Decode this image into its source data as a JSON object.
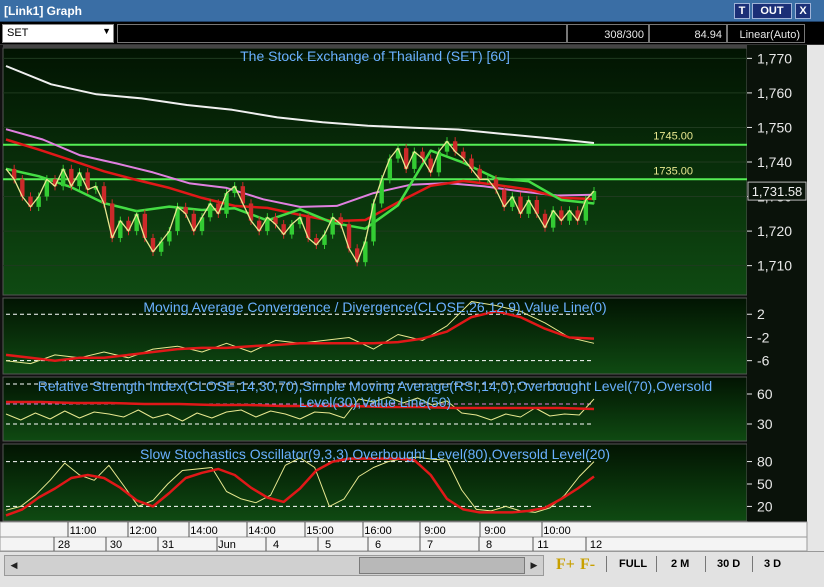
{
  "window": {
    "title": "[Link1] Graph",
    "buttons": [
      "T",
      "OUT",
      "X"
    ]
  },
  "toolbar": {
    "symbol": "SET",
    "count": "308/300",
    "value": "84.94",
    "scale": "Linear(Auto)"
  },
  "colors": {
    "bg": "#0d2a0d",
    "grid": "#3a4a3a",
    "green_up": "#33cc33",
    "red_down": "#cc2a2a",
    "line_white": "#f0f0f0",
    "line_pink": "#e080e0",
    "line_red": "#e01818",
    "line_green": "#44dd44",
    "line_yellow": "#e8e890",
    "level": "#55ee55"
  },
  "chart_data": [
    {
      "type": "line",
      "title": "The Stock Exchange of Thailand (SET) [60]",
      "y_ticks": [
        1770,
        1760,
        1750,
        1740,
        1730,
        1720,
        1710
      ],
      "ylim": [
        1701.5,
        1773
      ],
      "price_label": "1,731.58",
      "annotations": [
        {
          "label": "1745.00",
          "y": 1745
        },
        {
          "label": "1735.00",
          "y": 1735
        }
      ],
      "series": [
        {
          "values": [
            1738,
            1735,
            1730,
            1727,
            1730,
            1735,
            1733,
            1738,
            1733,
            1737,
            1732,
            1733,
            1728,
            1718,
            1723,
            1720,
            1725,
            1718,
            1714,
            1717,
            1720,
            1727,
            1725,
            1720,
            1724,
            1728,
            1725,
            1731,
            1733,
            1728,
            1723,
            1720,
            1724,
            1722,
            1719,
            1722,
            1724,
            1718,
            1716,
            1719,
            1724,
            1722,
            1715,
            1711,
            1717,
            1728,
            1735,
            1741,
            1744,
            1738,
            1743,
            1741,
            1737,
            1743,
            1746,
            1743,
            1741,
            1738,
            1735,
            1735,
            1732,
            1727,
            1730,
            1725,
            1729,
            1725,
            1721,
            1726,
            1723,
            1726,
            1723,
            1729,
            1731.58
          ]
        },
        {
          "values": [
            1767.8,
            1762.5,
            1759.6,
            1758.4,
            1756.5,
            1755.1,
            1752.9,
            1751.5,
            1750.5,
            1749.9,
            1749.4,
            1748.1,
            1746.9,
            1745.5
          ]
        },
        {
          "values": [
            1749.5,
            1746.5,
            1742,
            1739.6,
            1737,
            1733.8,
            1732.5,
            1729.2,
            1727,
            1727.3,
            1731,
            1733.4,
            1733.9,
            1733,
            1731.5,
            1730.3,
            1730.5
          ]
        },
        {
          "values": [
            1746.5,
            1743.6,
            1740.5,
            1737.3,
            1734.8,
            1732.5,
            1729.6,
            1727.3,
            1726.7,
            1724.7,
            1722.9,
            1723.2,
            1728.3,
            1733.1,
            1734.5,
            1733.4,
            1732,
            1729.6,
            1729.3
          ]
        },
        {
          "values": [
            1738,
            1735.9,
            1732.7,
            1728.1,
            1725.8,
            1727.1,
            1726.1,
            1726.6,
            1723.1,
            1726.3,
            1722.4,
            1720.7,
            1727.5,
            1743.3,
            1739.8,
            1735.3,
            1734.4,
            1729,
            1728
          ]
        }
      ]
    },
    {
      "type": "line",
      "title": "Moving Average Convergence / Divergence(CLOSE,26,12,9),Value Line(0)",
      "y_ticks": [
        2,
        -2,
        -6
      ],
      "ylim": [
        -8.3,
        4.8
      ],
      "series": [
        {
          "values": [
            -6,
            -6.5,
            -5,
            -5.5,
            -4.5,
            -5.5,
            -4,
            -3.5,
            -4.5,
            -3,
            -4.5,
            -2.5,
            -3,
            -2.5,
            -2,
            -4,
            -1.5,
            -2.5,
            0,
            4.2,
            3.5,
            2.5,
            0.5,
            -2,
            -3
          ]
        },
        {
          "values": [
            -5,
            -5.5,
            -6,
            -5.5,
            -5.5,
            -5,
            -4.5,
            -4,
            -3.8,
            -3.8,
            -3.5,
            -3.3,
            -3,
            -3,
            -3,
            -3,
            -2.8,
            -2.2,
            -1,
            1.5,
            2.5,
            1.5,
            -0.5,
            -2,
            -2.2
          ]
        }
      ]
    },
    {
      "type": "line",
      "title": "Relative Strength Index(CLOSE,14,30,70),Simple Moving Average(RSI,14,0),Overbought Level(70),Oversold Level(30),Value Line(50)",
      "y_ticks": [
        60,
        30
      ],
      "ylim": [
        13,
        77
      ],
      "series": [
        {
          "values": [
            40,
            34,
            41,
            35,
            43,
            36,
            42,
            40,
            37,
            44,
            36,
            40,
            33,
            41,
            36,
            42,
            44,
            37,
            43,
            40,
            35,
            42,
            41,
            36,
            55,
            52,
            57,
            51,
            56,
            49,
            53,
            41,
            39,
            34,
            40,
            37,
            46,
            38,
            40,
            39,
            55
          ]
        },
        {
          "values": [
            52,
            52,
            51,
            51,
            50,
            50,
            49,
            49,
            48,
            48,
            48,
            47,
            47,
            46,
            46,
            46,
            46,
            45
          ]
        }
      ]
    },
    {
      "type": "line",
      "title": "Slow Stochastics Oscillator(9,3,3),Overbought Level(80),Oversold Level(20)",
      "y_ticks": [
        80,
        50,
        20
      ],
      "ylim": [
        0.5,
        103.5
      ],
      "series": [
        {
          "values": [
            15,
            20,
            35,
            55,
            78,
            62,
            55,
            75,
            48,
            20,
            28,
            50,
            68,
            70,
            72,
            40,
            30,
            25,
            35,
            75,
            85,
            72,
            20,
            30,
            60,
            72,
            80,
            84,
            86,
            83,
            82,
            42,
            16,
            14,
            20,
            14,
            12,
            18,
            35,
            60,
            80
          ]
        },
        {
          "values": [
            8,
            16,
            32,
            44,
            58,
            62,
            58,
            45,
            28,
            20,
            38,
            58,
            65,
            70,
            62,
            45,
            32,
            26,
            44,
            68,
            80,
            84,
            84,
            84,
            84,
            82,
            62,
            30,
            16,
            12,
            12,
            12,
            14,
            18,
            30,
            44,
            60
          ]
        }
      ]
    }
  ],
  "x_axis": {
    "time_ticks": [
      "11:00",
      "12:00",
      "14:00",
      "14:00",
      "15:00",
      "16:00",
      "9:00",
      "9:00",
      "10:00"
    ],
    "date_ticks": [
      "28",
      "30",
      "31",
      "Jun",
      "4",
      "5",
      "6",
      "7",
      "8",
      "11",
      "12"
    ]
  },
  "bottom": {
    "fplus": "F+",
    "fminus": "F-",
    "periods": [
      "FULL",
      "2 M",
      "30 D",
      "3 D"
    ]
  }
}
